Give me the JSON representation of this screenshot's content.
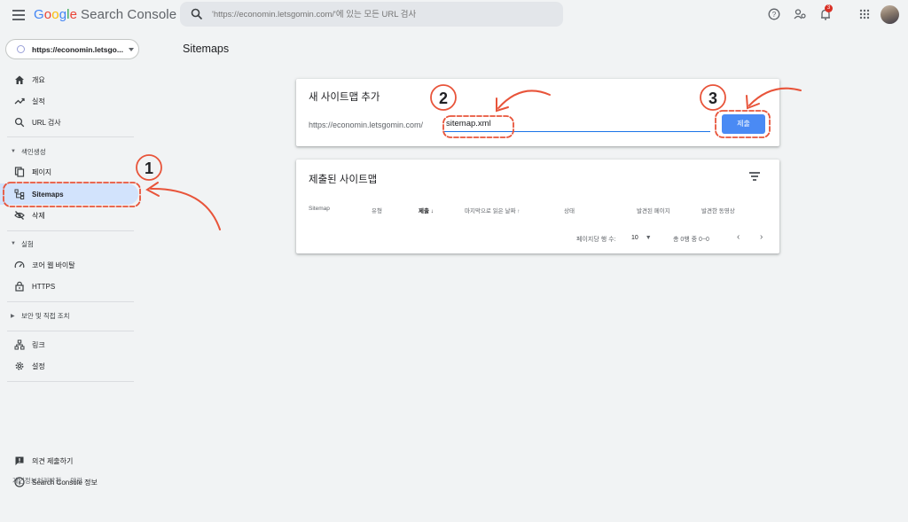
{
  "app": {
    "brand_letters": [
      "G",
      "o",
      "o",
      "g",
      "l",
      "e"
    ],
    "brand_rest": "Search Console",
    "search_placeholder": "'https://economin.letsgomin.com/'에 있는 모든 URL 검사",
    "notification_count": "3"
  },
  "sidebar": {
    "property": "https://economin.letsgo...",
    "items": {
      "overview": "개요",
      "performance": "실적",
      "url_inspection": "URL 검사",
      "indexing_header": "색인생성",
      "pages": "페이지",
      "sitemaps": "Sitemaps",
      "removals": "삭제",
      "experience_header": "실험",
      "core_web_vitals": "코어 웹 바이탈",
      "https": "HTTPS",
      "security_header": "보안 및 직접 조치",
      "links": "링크",
      "settings": "설정",
      "feedback": "의견 제출하기",
      "about": "Search Console 정보"
    },
    "footer": {
      "privacy": "개인정보처리방침",
      "terms": "약관"
    }
  },
  "main": {
    "page_title": "Sitemaps",
    "add_card": {
      "title": "새 사이트맵 추가",
      "url_prefix": "https://economin.letsgomin.com/",
      "input_value": "sitemap.xml",
      "submit_label": "제출"
    },
    "submitted_card": {
      "title": "제출된 사이트맵",
      "columns": [
        "Sitemap",
        "유형",
        "제출",
        "마지막으로 읽은 날짜",
        "상태",
        "발견된 페이지",
        "발견한 동영상"
      ],
      "rows_per_page_label": "페이지당 행 수:",
      "rows_per_page_value": "10",
      "range_text": "총 0행 중 0~0"
    }
  },
  "annotations": [
    "1",
    "2",
    "3"
  ],
  "colors": {
    "accent": "#1a73e8",
    "annotation": "#e8543a",
    "active_nav": "#d2e3fc",
    "submit_button": "#4a8af4"
  }
}
